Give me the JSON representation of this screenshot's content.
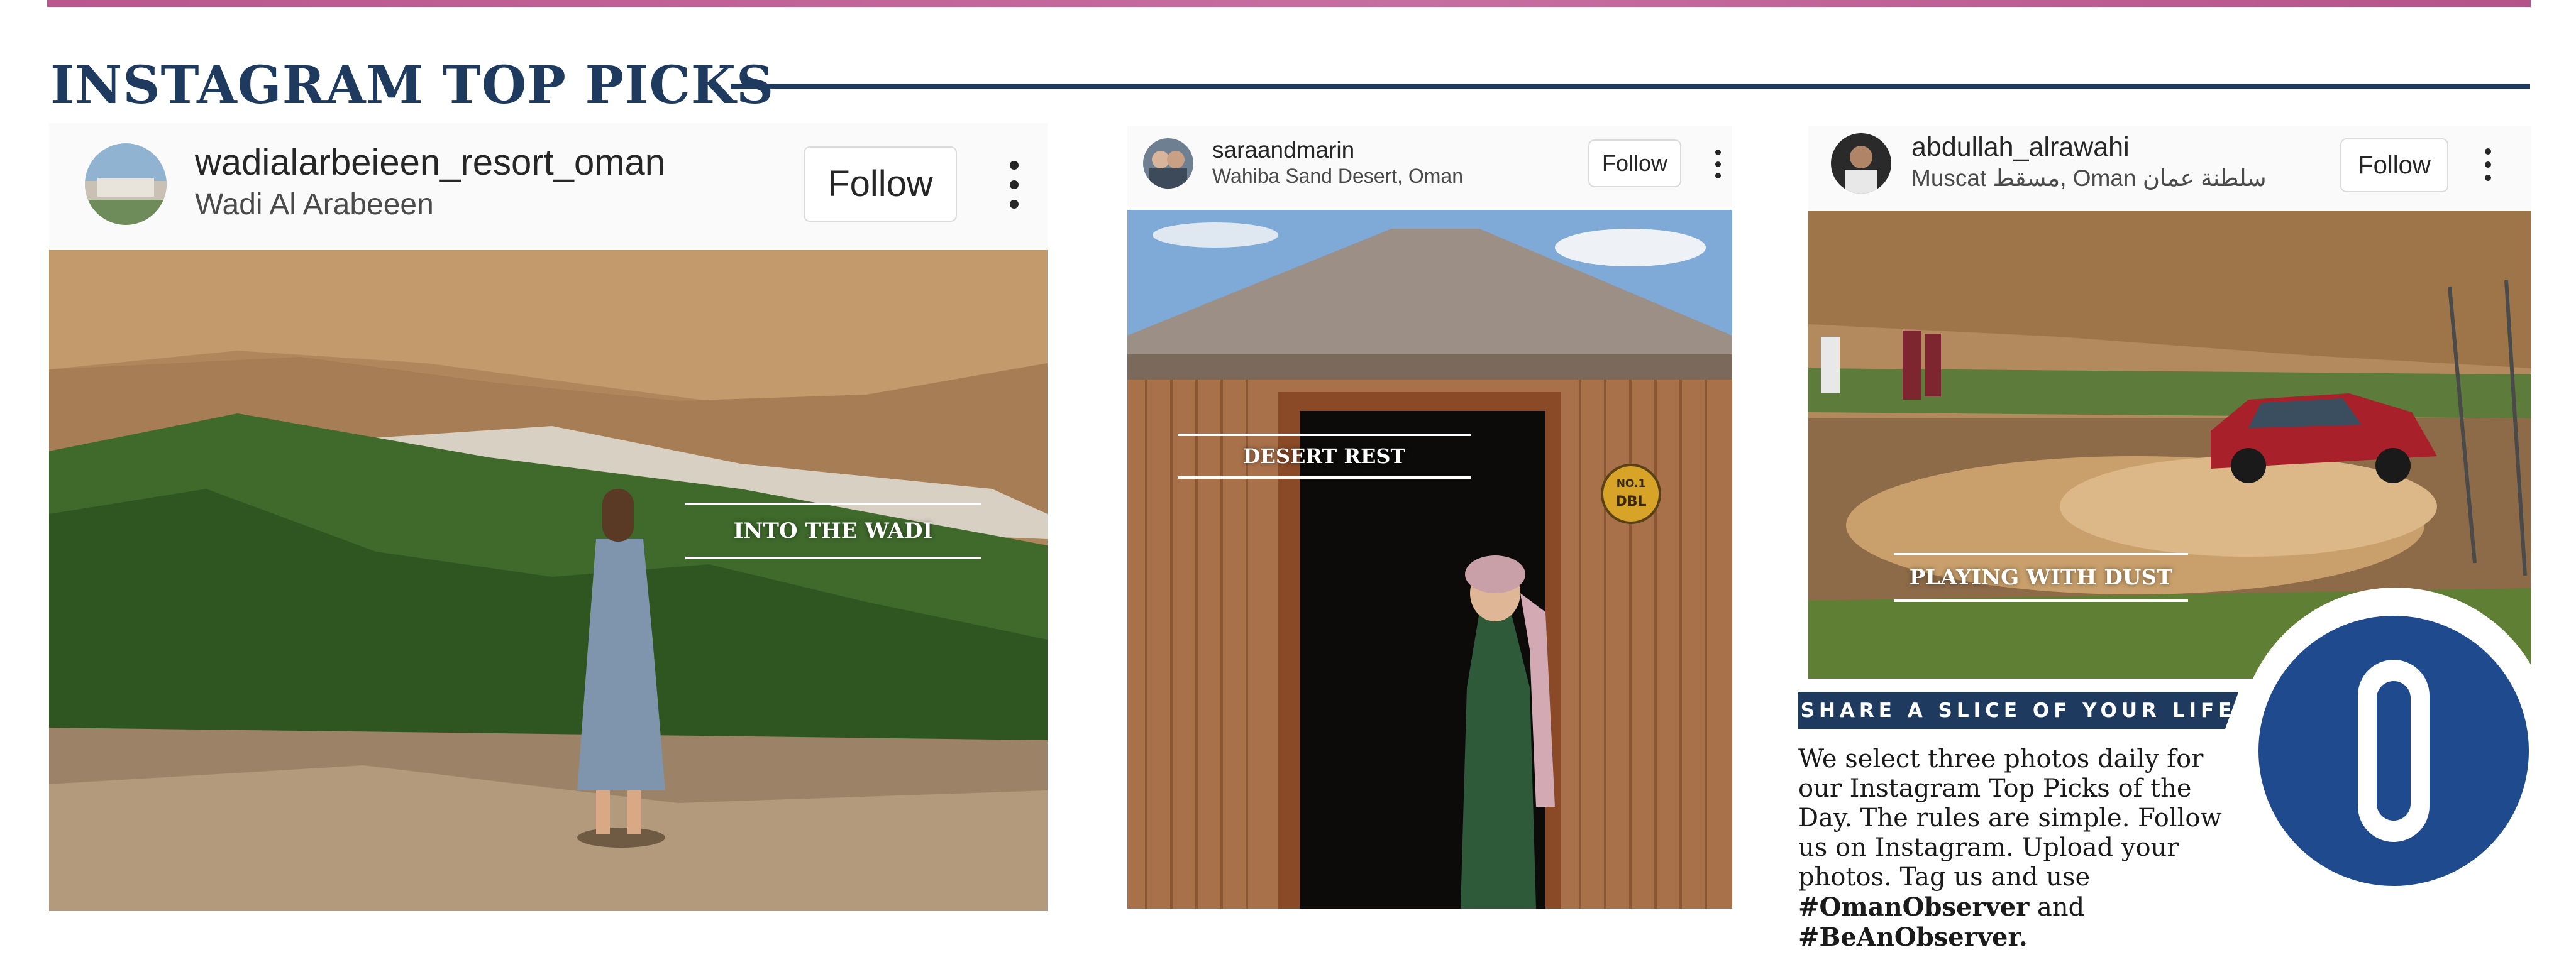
{
  "section": {
    "title": "INSTAGRAM TOP PICKS"
  },
  "posts": [
    {
      "username": "wadialarbeieen_resort_oman",
      "location": "Wadi Al Arabeeen",
      "follow_label": "Follow",
      "caption": "INTO THE WADI",
      "avatar_icon": "profile-avatar-icon",
      "menu_icon": "more-vertical-icon"
    },
    {
      "username": "saraandmarin",
      "location": "Wahiba Sand Desert, Oman",
      "follow_label": "Follow",
      "caption": "DESERT REST",
      "sign_top": "NO.1",
      "sign_bottom": "DBL",
      "avatar_icon": "profile-avatar-icon",
      "menu_icon": "more-vertical-icon"
    },
    {
      "username": "abdullah_alrawahi",
      "location": "Muscat مسقط, Oman سلطنة عمان",
      "follow_label": "Follow",
      "caption": "PLAYING WITH DUST",
      "avatar_icon": "profile-avatar-icon",
      "menu_icon": "more-vertical-icon"
    }
  ],
  "share": {
    "banner": "SHARE A SLICE OF YOUR LIFE",
    "body": "We select three photos daily for our Instagram Top Picks of the Day. The rules are simple. Follow us on Instagram. Upload your photos. Tag us and use",
    "hashtag1": "#OmanObserver",
    "connector": " and ",
    "hashtag2": "#BeAnObserver."
  },
  "logo": {
    "letter": "O"
  },
  "colors": {
    "brand_navy": "#1e3a5f",
    "top_band_pink": "#b9578e",
    "logo_blue": "#1f4a8e"
  }
}
